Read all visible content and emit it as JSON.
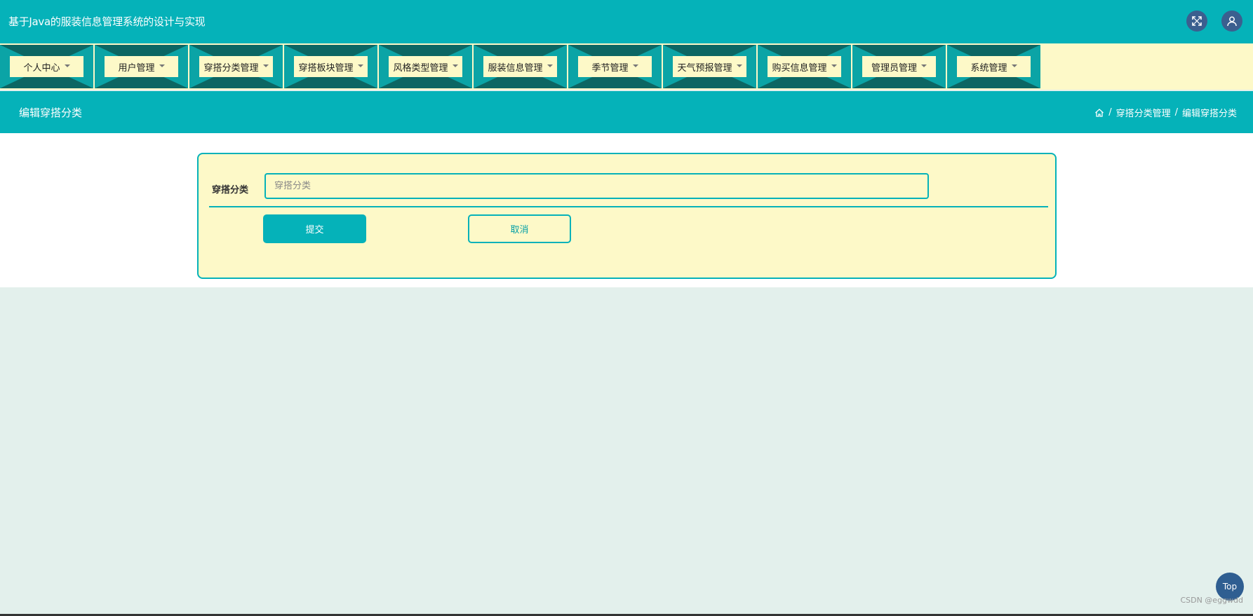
{
  "app": {
    "title": "基于Java的服装信息管理系统的设计与实现"
  },
  "header_icons": {
    "fullscreen": "expand-icon",
    "user": "user-icon"
  },
  "menu": {
    "items": [
      {
        "label": "个人中心"
      },
      {
        "label": "用户管理"
      },
      {
        "label": "穿搭分类管理"
      },
      {
        "label": "穿搭板块管理"
      },
      {
        "label": "风格类型管理"
      },
      {
        "label": "服装信息管理"
      },
      {
        "label": "季节管理"
      },
      {
        "label": "天气预报管理"
      },
      {
        "label": "购买信息管理"
      },
      {
        "label": "管理员管理"
      },
      {
        "label": "系统管理"
      }
    ]
  },
  "page": {
    "title": "编辑穿搭分类",
    "breadcrumb": [
      "穿搭分类管理",
      "编辑穿搭分类"
    ],
    "separator": "/"
  },
  "form": {
    "field_label": "穿搭分类",
    "field_placeholder": "穿搭分类",
    "field_value": "",
    "submit_label": "提交",
    "cancel_label": "取消"
  },
  "floating": {
    "top_label": "Top"
  },
  "watermark": "CSDN @eggwdd",
  "colors": {
    "primary": "#05b2b9",
    "cream": "#fdf9c8",
    "background": "#e3f0ec",
    "icon_bg": "#3b5f8f"
  }
}
